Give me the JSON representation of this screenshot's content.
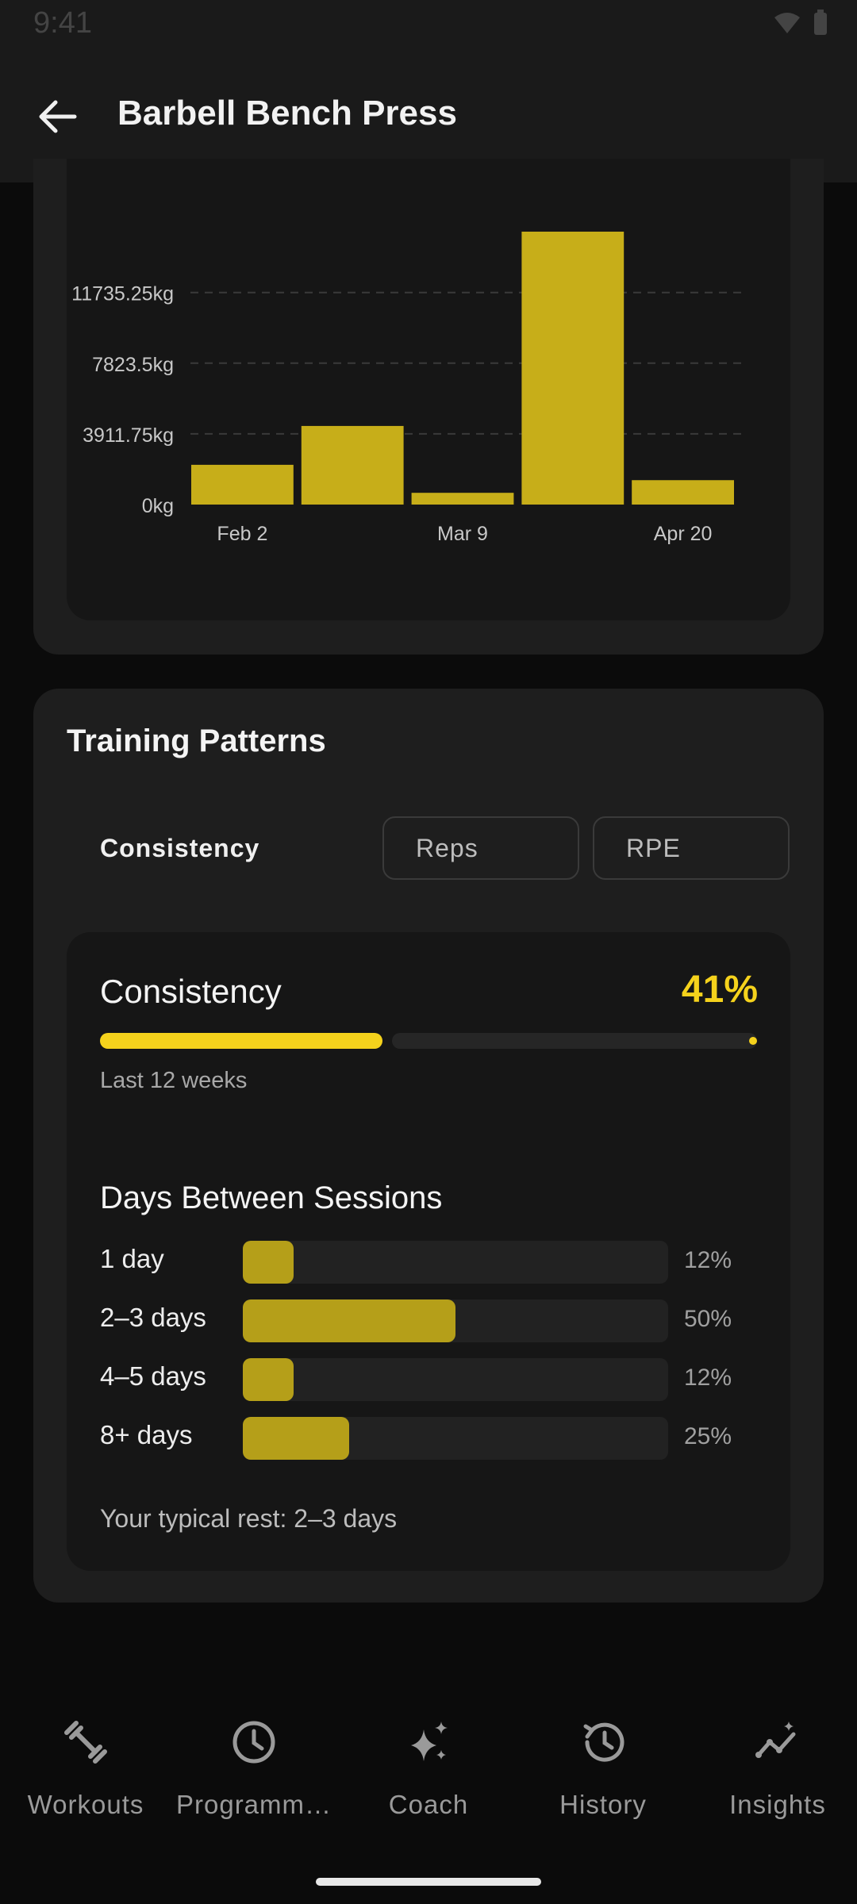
{
  "status": {
    "time": "9:41"
  },
  "header": {
    "title": "Barbell Bench Press",
    "back_icon": "arrow-left-icon"
  },
  "chart_data": {
    "type": "bar",
    "categories": [
      "",
      "Feb 2",
      "",
      "Mar 9",
      "",
      "Apr 20"
    ],
    "x_tick_labels": [
      "Feb 2",
      "Mar 9",
      "Apr 20"
    ],
    "y_tick_labels": [
      "0kg",
      "3911.75kg",
      "7823.5kg",
      "11735.25kg"
    ],
    "values": [
      2200,
      4350,
      650,
      15600,
      1350
    ],
    "ylim": [
      0,
      15647
    ],
    "grid": true,
    "bar_color": "#c7ae19"
  },
  "patterns": {
    "title": "Training Patterns",
    "tabs": [
      {
        "label": "Consistency",
        "active": true
      },
      {
        "label": "Reps",
        "active": false
      },
      {
        "label": "RPE",
        "active": false
      }
    ],
    "consistency": {
      "title": "Consistency",
      "percent_label": "41%",
      "percent": 41,
      "subtitle": "Last 12 weeks",
      "accent": "#f5d21c"
    },
    "distribution": {
      "title": "Days Between Sessions",
      "rows": [
        {
          "label": "1 day",
          "pct_label": "12%",
          "pct": 12
        },
        {
          "label": "2–3 days",
          "pct_label": "50%",
          "pct": 50
        },
        {
          "label": "4–5 days",
          "pct_label": "12%",
          "pct": 12
        },
        {
          "label": "8+ days",
          "pct_label": "25%",
          "pct": 25
        }
      ],
      "typical_text": "Your typical rest: 2–3 days"
    }
  },
  "nav": {
    "items": [
      {
        "label": "Workouts",
        "icon": "dumbbell-icon"
      },
      {
        "label": "Programm…",
        "icon": "clock-icon"
      },
      {
        "label": "Coach",
        "icon": "sparkle-icon"
      },
      {
        "label": "History",
        "icon": "history-icon"
      },
      {
        "label": "Insights",
        "icon": "insights-icon"
      }
    ]
  }
}
